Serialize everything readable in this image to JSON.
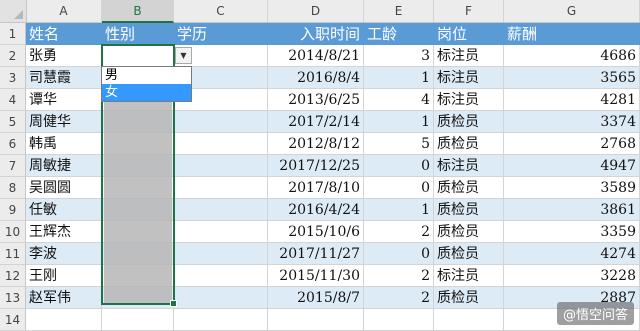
{
  "columns": [
    "A",
    "B",
    "C",
    "D",
    "E",
    "F",
    "G"
  ],
  "row_numbers": [
    "1",
    "2",
    "3",
    "4",
    "5",
    "6",
    "7",
    "8",
    "9",
    "10",
    "11",
    "12",
    "13",
    "14"
  ],
  "headers": [
    "姓名",
    "性别",
    "学历",
    "入职时间",
    "工龄",
    "岗位",
    "薪酬"
  ],
  "rows": [
    [
      "张勇",
      "",
      "",
      "2014/8/21",
      "3",
      "标注员",
      "4686"
    ],
    [
      "司慧霞",
      "",
      "",
      "2016/8/4",
      "1",
      "标注员",
      "3565"
    ],
    [
      "谭华",
      "",
      "",
      "2013/6/25",
      "4",
      "标注员",
      "4281"
    ],
    [
      "周健华",
      "",
      "",
      "2017/2/14",
      "1",
      "质检员",
      "3374"
    ],
    [
      "韩禹",
      "",
      "",
      "2012/8/12",
      "5",
      "质检员",
      "2768"
    ],
    [
      "周敏捷",
      "",
      "",
      "2017/12/25",
      "0",
      "标注员",
      "4947"
    ],
    [
      "吴圆圆",
      "",
      "",
      "2017/8/10",
      "0",
      "质检员",
      "3589"
    ],
    [
      "任敏",
      "",
      "",
      "2016/4/24",
      "1",
      "质检员",
      "3861"
    ],
    [
      "王辉杰",
      "",
      "",
      "2015/10/6",
      "2",
      "质检员",
      "3359"
    ],
    [
      "李波",
      "",
      "",
      "2017/11/27",
      "0",
      "质检员",
      "4274"
    ],
    [
      "王刚",
      "",
      "",
      "2015/11/30",
      "2",
      "标注员",
      "3228"
    ],
    [
      "赵军伟",
      "",
      "",
      "2015/8/7",
      "2",
      "质检员",
      "2887"
    ]
  ],
  "dropdown": {
    "options": [
      "男",
      "女"
    ],
    "highlighted": "女",
    "arrow": "▼"
  },
  "selection": {
    "range": "B2:B13",
    "active_column": "B"
  },
  "watermark": "@悟空问答",
  "colors": {
    "header_bg": "#5b9bd5",
    "band_bg": "#ddebf7",
    "selection": "#217346"
  }
}
